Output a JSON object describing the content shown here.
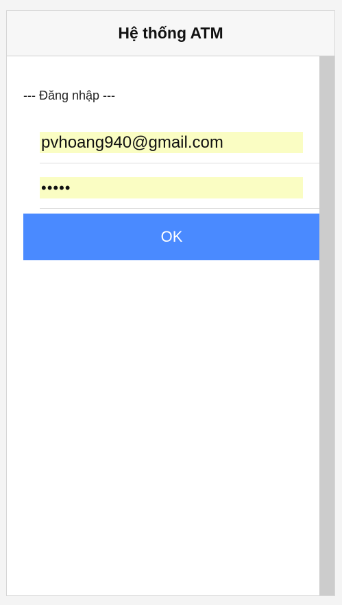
{
  "header": {
    "title": "Hệ thống ATM"
  },
  "login": {
    "section_label": "--- Đăng nhập ---",
    "email_value": "pvhoang940@gmail.com",
    "password_value": "•••••",
    "ok_label": "OK"
  },
  "colors": {
    "header_bg": "#f7f7f7",
    "input_autofill_bg": "#fafdc3",
    "button_bg": "#4a8aff",
    "scrollbar": "#cccccc"
  }
}
